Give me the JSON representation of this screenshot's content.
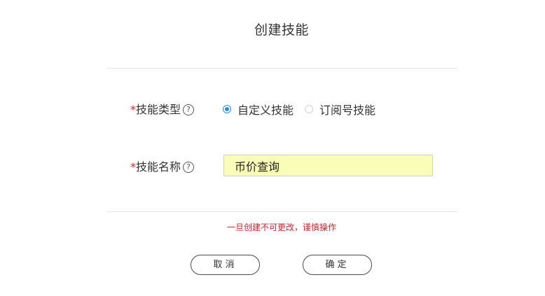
{
  "dialog": {
    "title": "创建技能",
    "required_mark": "*",
    "help_glyph": "?",
    "skill_type": {
      "label": "技能类型",
      "options": [
        {
          "label": "自定义技能",
          "checked": true
        },
        {
          "label": "订阅号技能",
          "checked": false
        }
      ]
    },
    "skill_name": {
      "label": "技能名称",
      "value": "币价查询"
    },
    "warning": "一旦创建不可更改，谨慎操作",
    "buttons": {
      "cancel": "取消",
      "confirm": "确定"
    }
  },
  "colors": {
    "required": "#e02020",
    "radio_checked": "#2a8ae0",
    "input_background": "#fafdb8",
    "warning": "#c2272d"
  },
  "icons": [
    "help-circle-icon",
    "radio-checked-icon",
    "radio-unchecked-icon"
  ]
}
